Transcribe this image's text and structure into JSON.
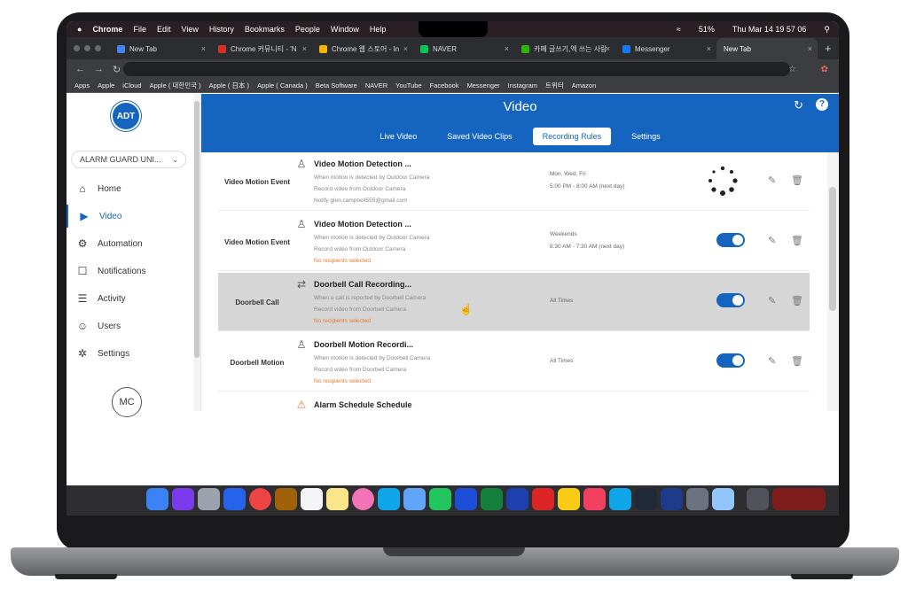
{
  "menubar": {
    "apple_icon": "apple-icon",
    "app": "Chrome",
    "menus": [
      "File",
      "Edit",
      "View",
      "History",
      "Bookmarks",
      "People",
      "Window",
      "Help"
    ],
    "battery": "51%",
    "clock": "Thu Mar 14  19 57 06"
  },
  "tabs": [
    {
      "title": "New Tab",
      "color": "#4285f4"
    },
    {
      "title": "Chrome 커뮤니티 - 'N",
      "color": "#d93025"
    },
    {
      "title": "Chrome 웹 스토어 - In",
      "color": "#f4b400"
    },
    {
      "title": "NAVER",
      "color": "#03c75a"
    },
    {
      "title": "카페 글쓰기,엑 쓰는 사람",
      "color": "#2db400"
    },
    {
      "title": "Messenger",
      "color": "#1877f2"
    },
    {
      "title": "New Tab",
      "color": "#4285f4"
    }
  ],
  "bookmarks": [
    "Apps",
    "Apple",
    "iCloud",
    "Apple ( 대한민국 )",
    "Apple ( 日本 )",
    "Apple ( Canada )",
    "Beta Software",
    "NAVER",
    "YouTube",
    "Facebook",
    "Messenger",
    "Instagram",
    "트위터",
    "Amazon"
  ],
  "sidebar": {
    "logo": "ADT",
    "account": "ALARM GUARD UNI...",
    "items": [
      {
        "label": "Home",
        "icon": "home-icon",
        "glyph": "⌂"
      },
      {
        "label": "Video",
        "icon": "video-camera-icon",
        "glyph": "▶",
        "active": true
      },
      {
        "label": "Automation",
        "icon": "automation-icon",
        "glyph": "⚙"
      },
      {
        "label": "Notifications",
        "icon": "notifications-icon",
        "glyph": "☐"
      },
      {
        "label": "Activity",
        "icon": "activity-icon",
        "glyph": "☰"
      },
      {
        "label": "Users",
        "icon": "users-icon",
        "glyph": "☺"
      },
      {
        "label": "Settings",
        "icon": "settings-icon",
        "glyph": "✲"
      }
    ],
    "avatar": "MC"
  },
  "header": {
    "title": "Video",
    "tabs": [
      "Live Video",
      "Saved Video Clips",
      "Recording Rules",
      "Settings"
    ],
    "active_tab": "Recording Rules"
  },
  "rules": [
    {
      "label": "Video Motion Event",
      "title": "Video Motion Detection ...",
      "icon": "person-icon",
      "glyph": "♙",
      "lines": [
        "When motion is detected by Outdoor Camera",
        "Record video from Outdoor Camera",
        "Notify glen.campbell555@gmail.com"
      ],
      "warn_line": false,
      "schedule": [
        "Mon, Wed, Fri",
        "5:00 PM - 8:00 AM (next day)"
      ],
      "state": "loading"
    },
    {
      "label": "Video Motion Event",
      "title": "Video Motion Detection ...",
      "icon": "person-icon",
      "glyph": "♙",
      "lines": [
        "When motion is detected by Outdoor Camera",
        "Record video from Outdoor Camera",
        "No recipients selected"
      ],
      "warn_line": true,
      "schedule": [
        "Weekends",
        "8:30 AM - 7:30 AM (next day)"
      ],
      "state": "on"
    },
    {
      "label": "Doorbell Call",
      "title": "Doorbell Call Recording...",
      "icon": "transfer-arrows-icon",
      "glyph": "⇄",
      "lines": [
        "When a call is reported by Doorbell Camera",
        "Record video from Doorbell Camera",
        "No recipients selected"
      ],
      "warn_line": true,
      "schedule": [
        "All Times"
      ],
      "state": "on",
      "highlighted": true
    },
    {
      "label": "Doorbell Motion",
      "title": "Doorbell Motion Recordi...",
      "icon": "person-icon",
      "glyph": "♙",
      "lines": [
        "When motion is detected by Doorbell Camera",
        "Record video from Doorbell Camera",
        "No recipients selected"
      ],
      "warn_line": true,
      "schedule": [
        "All Times"
      ],
      "state": "on"
    },
    {
      "label": "",
      "title": "Alarm Schedule Schedule",
      "icon": "warning-icon",
      "glyph": "⚠",
      "lines": [],
      "warn_line": false,
      "schedule": [],
      "state": "none"
    }
  ],
  "colors": {
    "brand": "#1565c0",
    "warning": "#e8782c"
  }
}
